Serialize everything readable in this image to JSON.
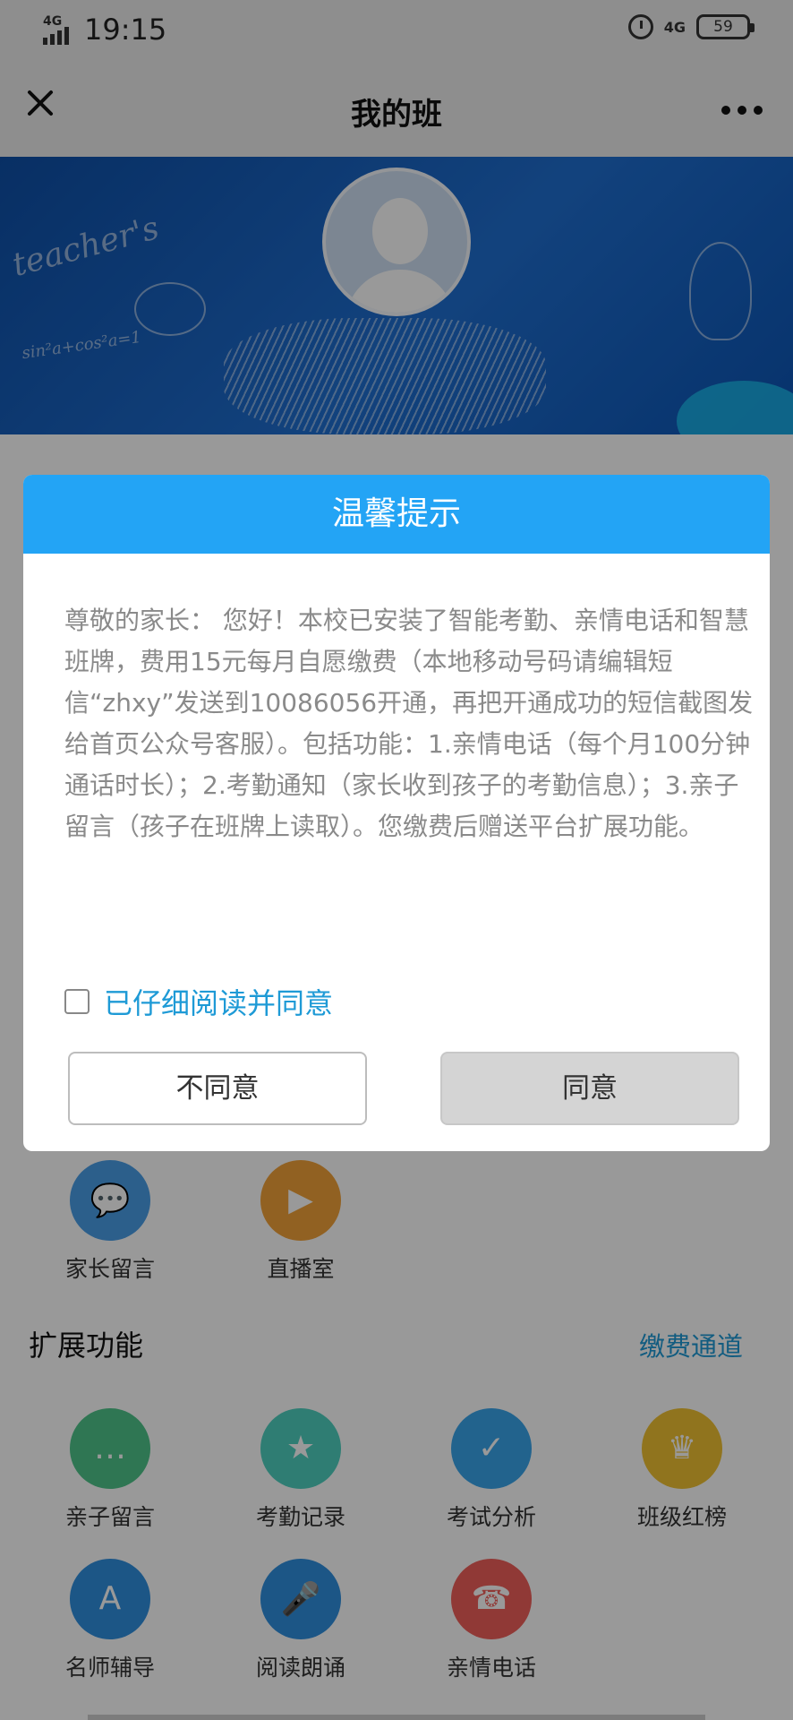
{
  "status_bar": {
    "network_tag": "4G",
    "time": "19:15",
    "net_right": "4G",
    "battery": "59"
  },
  "nav": {
    "title": "我的班"
  },
  "top_features": [
    {
      "label": "家长留言",
      "icon": "message-icon",
      "color": "#4a9fe8",
      "glyph": "💬"
    },
    {
      "label": "直播室",
      "icon": "video-camera-icon",
      "color": "#f2a23a",
      "glyph": "▶"
    }
  ],
  "extended": {
    "title": "扩展功能",
    "pay_link": "缴费通道",
    "items": [
      {
        "label": "亲子留言",
        "icon": "chat-bubble-icon",
        "color": "#4fc58a",
        "glyph": "…"
      },
      {
        "label": "考勤记录",
        "icon": "medal-icon",
        "color": "#4fd0c0",
        "glyph": "★"
      },
      {
        "label": "考试分析",
        "icon": "calendar-check-icon",
        "color": "#3aa5ec",
        "glyph": "✓"
      },
      {
        "label": "班级红榜",
        "icon": "trophy-icon",
        "color": "#f1c232",
        "glyph": "♛"
      },
      {
        "label": "名师辅导",
        "icon": "book-icon",
        "color": "#2f8fe0",
        "glyph": "A"
      },
      {
        "label": "阅读朗诵",
        "icon": "microphone-icon",
        "color": "#2f8fe0",
        "glyph": "🎤"
      },
      {
        "label": "亲情电话",
        "icon": "family-icon",
        "color": "#f0605a",
        "glyph": "☎"
      }
    ]
  },
  "modal": {
    "title": "温馨提示",
    "body": "尊敬的家长： 您好！本校已安装了智能考勤、亲情电话和智慧班牌，费用15元每月自愿缴费（本地移动号码请编辑短信“zhxy”发送到10086056开通，再把开通成功的短信截图发给首页公众号客服）。包括功能：1.亲情电话（每个月100分钟通话时长）；2.考勤通知（家长收到孩子的考勤信息）；3.亲子留言（孩子在班牌上读取）。您缴费后赠送平台扩展功能。",
    "agree_checkbox_label": "已仔细阅读并同意",
    "disagree_button": "不同意",
    "agree_button": "同意"
  }
}
